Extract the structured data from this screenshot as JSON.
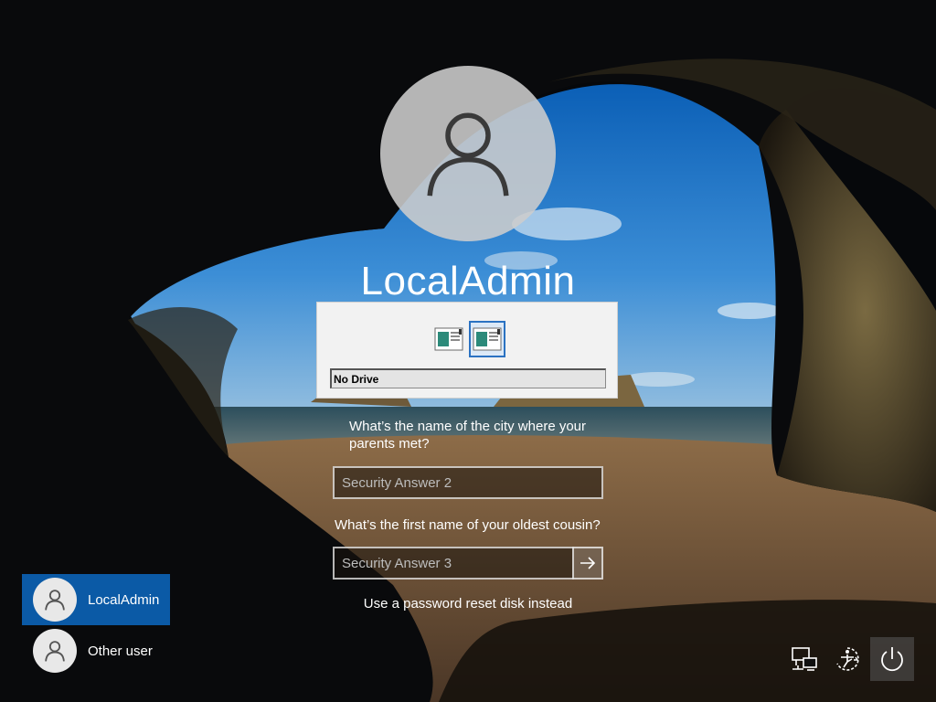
{
  "user": {
    "name": "LocalAdmin"
  },
  "drive_panel": {
    "selected_drive": "No Drive"
  },
  "security": {
    "question_2": "What’s the name of the city where your parents met?",
    "answer_2_placeholder": "Security Answer 2",
    "question_3": "What’s the first name of your oldest cousin?",
    "answer_3_placeholder": "Security Answer 3"
  },
  "reset_link": "Use a password reset disk instead",
  "user_list": [
    {
      "label": "LocalAdmin",
      "active": true
    },
    {
      "label": "Other user",
      "active": false
    }
  ],
  "system_icons": [
    "network-icon",
    "ease-of-access-icon",
    "power-icon"
  ],
  "colors": {
    "active_tile": "#0b5aa6",
    "selection_border": "#2b72c2"
  }
}
